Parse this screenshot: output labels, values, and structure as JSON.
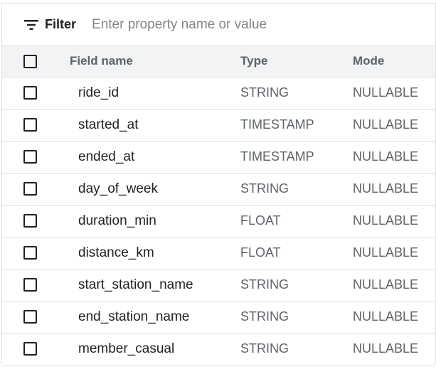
{
  "filter": {
    "label": "Filter",
    "placeholder": "Enter property name or value",
    "icon": "filter-list-icon"
  },
  "table": {
    "headers": {
      "field_name": "Field name",
      "type": "Type",
      "mode": "Mode"
    },
    "rows": [
      {
        "name": "ride_id",
        "type": "STRING",
        "mode": "NULLABLE"
      },
      {
        "name": "started_at",
        "type": "TIMESTAMP",
        "mode": "NULLABLE"
      },
      {
        "name": "ended_at",
        "type": "TIMESTAMP",
        "mode": "NULLABLE"
      },
      {
        "name": "day_of_week",
        "type": "STRING",
        "mode": "NULLABLE"
      },
      {
        "name": "duration_min",
        "type": "FLOAT",
        "mode": "NULLABLE"
      },
      {
        "name": "distance_km",
        "type": "FLOAT",
        "mode": "NULLABLE"
      },
      {
        "name": "start_station_name",
        "type": "STRING",
        "mode": "NULLABLE"
      },
      {
        "name": "end_station_name",
        "type": "STRING",
        "mode": "NULLABLE"
      },
      {
        "name": "member_casual",
        "type": "STRING",
        "mode": "NULLABLE"
      }
    ]
  },
  "colors": {
    "header_bg": "#f1f3f4",
    "border": "#dadce0",
    "text_primary": "#202124",
    "text_secondary": "#5f6368"
  }
}
